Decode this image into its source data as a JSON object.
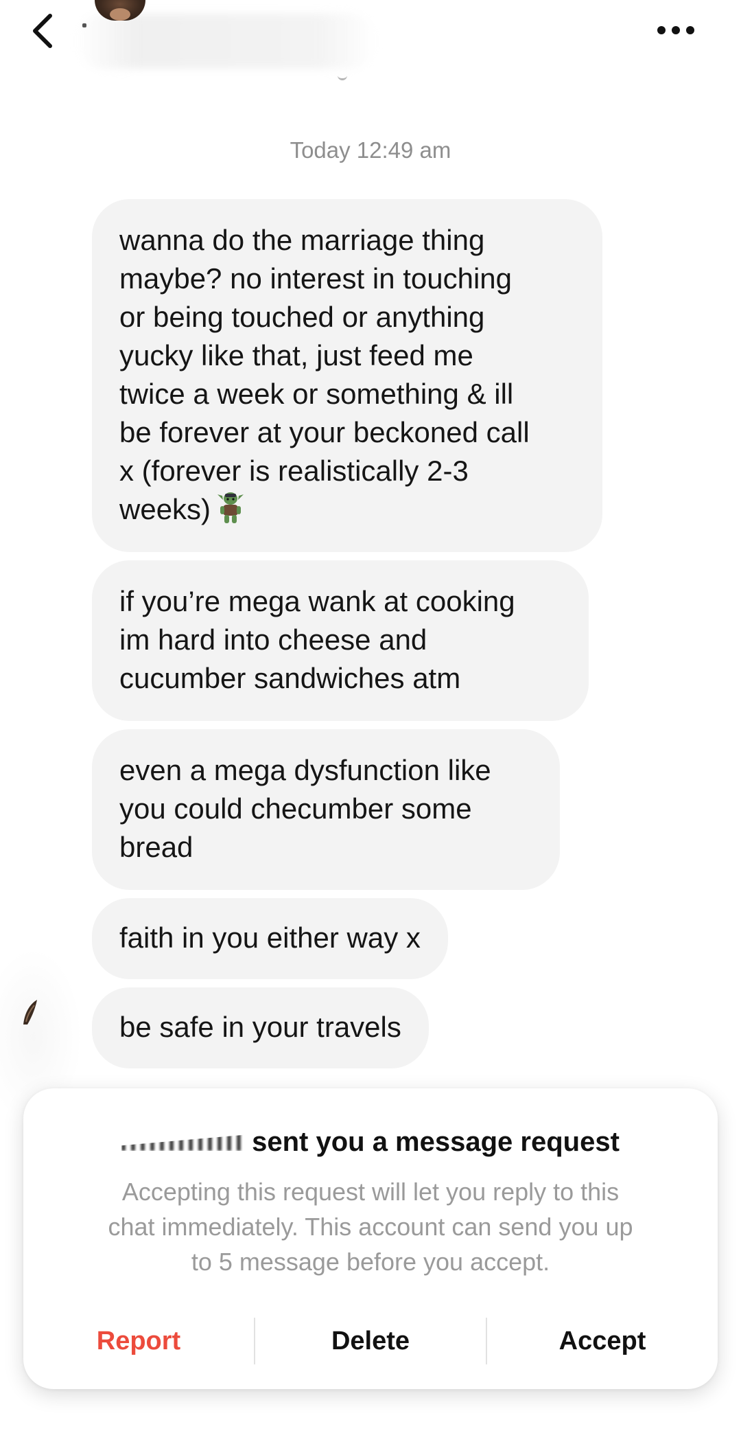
{
  "header": {
    "back_icon": "chevron-left-icon",
    "more_icon": "more-horizontal-icon"
  },
  "thread": {
    "timestamp": "Today 12:49 am",
    "messages": [
      {
        "lines": [
          "wanna do the marriage thing",
          "maybe? no interest in touching",
          "or being touched or anything",
          "yucky like that, just feed me",
          "twice a week or something & ill",
          "be forever at your beckoned call",
          "x (forever is realistically 2-3",
          "weeks)"
        ],
        "emoji": "goblin-emoji"
      },
      {
        "lines": [
          "if you’re mega wank at cooking",
          "im hard into cheese and",
          "cucumber sandwiches atm"
        ]
      },
      {
        "lines": [
          "even a mega dysfunction like",
          "you could checumber some",
          "bread"
        ]
      },
      {
        "lines": [
          "faith in you either way x"
        ]
      },
      {
        "lines": [
          "be safe in your travels"
        ]
      }
    ]
  },
  "request": {
    "title": "sent you a message request",
    "body_lines": [
      "Accepting this request will let you reply to this",
      "chat immediately. This account can send you up",
      "to 5 message before you accept."
    ],
    "report_label": "Report",
    "delete_label": "Delete",
    "accept_label": "Accept",
    "colors": {
      "report": "#ec4b3c",
      "bubble": "#f3f3f3"
    }
  }
}
